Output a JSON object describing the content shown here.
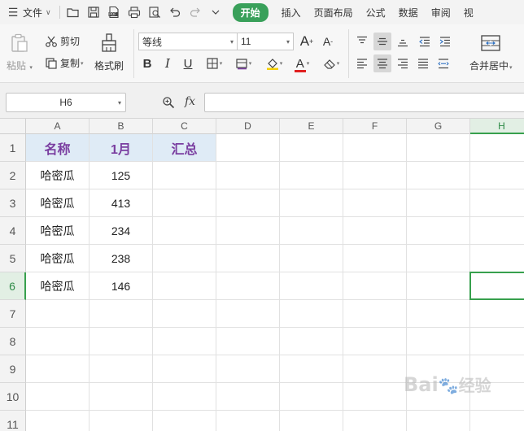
{
  "menubar": {
    "file_icon": "☰",
    "file_label": "文件",
    "chevron": "∨",
    "tabs": [
      {
        "label": "开始",
        "active": true
      },
      {
        "label": "插入"
      },
      {
        "label": "页面布局"
      },
      {
        "label": "公式"
      },
      {
        "label": "数据"
      },
      {
        "label": "审阅"
      },
      {
        "label": "视"
      }
    ]
  },
  "ribbon": {
    "paste_label": "粘贴",
    "cut_label": "剪切",
    "copy_label": "复制",
    "format_painter_label": "格式刷",
    "font_name": "等线",
    "font_size": "11",
    "increase_font": "A",
    "decrease_font": "A",
    "bold": "B",
    "italic": "I",
    "underline": "U",
    "font_color_letter": "A",
    "merge_center_label": "合并居中",
    "dropdown_mark": "▾"
  },
  "formula_bar": {
    "cell_ref": "H6",
    "fx": "fx",
    "content": ""
  },
  "sheet": {
    "columns": [
      "A",
      "B",
      "C",
      "D",
      "E",
      "F",
      "G",
      "H"
    ],
    "active_column": "H",
    "rows": [
      "1",
      "2",
      "3",
      "4",
      "5",
      "6",
      "7",
      "8",
      "9",
      "10",
      "11"
    ],
    "active_row": "6",
    "cells": [
      [
        "名称",
        "1月",
        "汇总"
      ],
      [
        "哈密瓜",
        "125",
        ""
      ],
      [
        "哈密瓜",
        "413",
        ""
      ],
      [
        "哈密瓜",
        "234",
        ""
      ],
      [
        "哈密瓜",
        "238",
        ""
      ],
      [
        "哈密瓜",
        "146",
        ""
      ]
    ]
  },
  "watermark": {
    "text": "Bai",
    "suffix": "经验"
  },
  "colors": {
    "accent": "#39a05a",
    "header_fill": "#dfebf6",
    "header_text": "#7a3ea0",
    "selection": "#37a04d"
  }
}
